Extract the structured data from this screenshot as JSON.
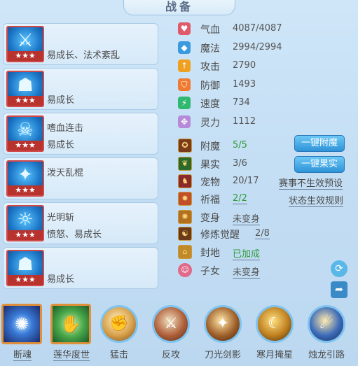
{
  "window": {
    "title": "战备"
  },
  "cards": [
    {
      "name": "",
      "sub": "易成长、法术紊乱",
      "stars": "★★★",
      "glyph": "⚔"
    },
    {
      "name": "",
      "sub": "易成长",
      "stars": "★★★",
      "glyph": "☗"
    },
    {
      "name": "嗜血连击",
      "sub": "易成长",
      "stars": "★★★",
      "glyph": "☠"
    },
    {
      "name": "泼天乱棍",
      "sub": "",
      "stars": "★★★",
      "glyph": "✦"
    },
    {
      "name": "光明斩",
      "sub": "愤怒、易成长",
      "stars": "★★★",
      "glyph": "☼"
    },
    {
      "name": "",
      "sub": "易成长",
      "stars": "★★★",
      "glyph": "☗"
    }
  ],
  "stats": [
    {
      "icon": "heart-icon",
      "glyph": "♥",
      "color": "#e05a6a",
      "label": "气血",
      "value": "4087/4087"
    },
    {
      "icon": "mana-icon",
      "glyph": "◆",
      "color": "#3a9ae0",
      "label": "魔法",
      "value": "2994/2994"
    },
    {
      "icon": "attack-icon",
      "glyph": "↑",
      "color": "#f0a020",
      "label": "攻击",
      "value": "2790"
    },
    {
      "icon": "defense-icon",
      "glyph": "⛉",
      "color": "#f07a30",
      "label": "防御",
      "value": "1493"
    },
    {
      "icon": "speed-icon",
      "glyph": "⚡",
      "color": "#2fb870",
      "label": "速度",
      "value": "734"
    },
    {
      "icon": "spirit-icon",
      "glyph": "✥",
      "color": "#b58ad8",
      "label": "灵力",
      "value": "1112"
    }
  ],
  "rows": {
    "fumo": {
      "label": "附魔",
      "value": "5/5",
      "glyph": "✪"
    },
    "guoshi": {
      "label": "果实",
      "value": "3/6",
      "glyph": "❦"
    },
    "chongwu": {
      "label": "宠物",
      "value": "20/17",
      "glyph": "♞"
    },
    "qifu": {
      "label": "祈福",
      "value": "2/2",
      "glyph": "✹"
    },
    "bianshen": {
      "label": "变身",
      "value": "未变身",
      "glyph": "✺"
    },
    "xiulian": {
      "label": "修炼觉醒",
      "value": "2/8",
      "glyph": "☯"
    },
    "fengdi": {
      "label": "封地",
      "value": "已加成",
      "glyph": "⌂"
    },
    "zinv": {
      "label": "子女",
      "value": "未变身",
      "glyph": "☺"
    }
  },
  "buttons": {
    "fumo": "一键附魔",
    "guoshi": "一键果实"
  },
  "links": {
    "preset": "赛事不生效预设",
    "rules": "状态生效规则"
  },
  "skills": [
    {
      "name": "断魂",
      "glyph": "✺",
      "kind": "square",
      "bg": "#1a4a8a"
    },
    {
      "name": "莲华度世",
      "glyph": "✋",
      "kind": "square",
      "bg": "#2f9a4a"
    },
    {
      "name": "猛击",
      "glyph": "✊",
      "kind": "orb"
    },
    {
      "name": "反攻",
      "glyph": "⚔",
      "kind": "orb"
    },
    {
      "name": "刀光剑影",
      "glyph": "✦",
      "kind": "orb"
    },
    {
      "name": "寒月掩星",
      "glyph": "☾",
      "kind": "orb"
    },
    {
      "name": "烛龙引路",
      "glyph": "☄",
      "kind": "orb"
    }
  ],
  "colors": {
    "accent": "#2e93d8",
    "green": "#2f9a3a",
    "card_border": "#a9cbe6"
  }
}
